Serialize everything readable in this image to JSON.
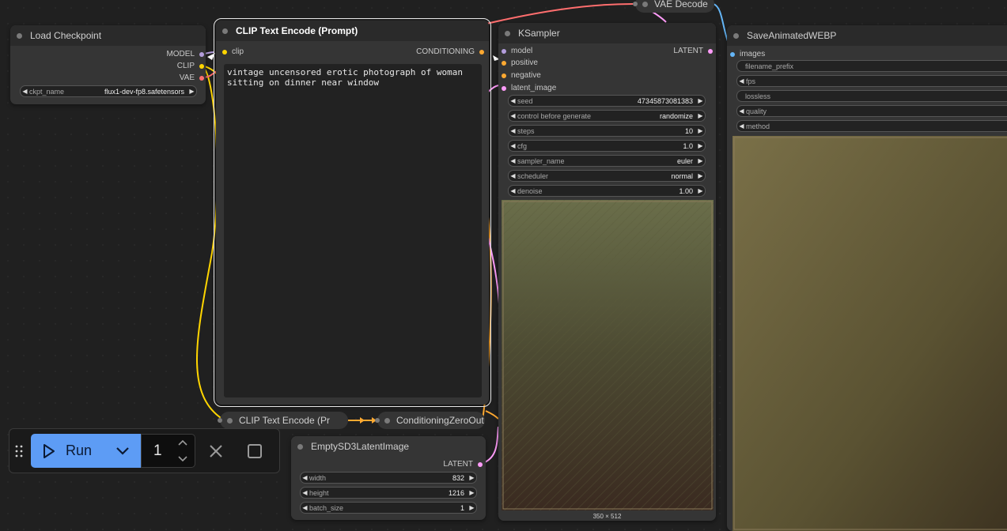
{
  "nodes": {
    "load_checkpoint": {
      "title": "Load Checkpoint",
      "outputs": [
        "MODEL",
        "CLIP",
        "VAE"
      ],
      "widget": {
        "label": "ckpt_name",
        "value": "flux1-dev-fp8.safetensors"
      }
    },
    "clip_text_encode": {
      "title": "CLIP Text Encode (Prompt)",
      "input": "clip",
      "output": "CONDITIONING",
      "prompt": "vintage uncensored erotic photograph of woman\nsitting on dinner near window"
    },
    "ksampler": {
      "title": "KSampler",
      "inputs": [
        "model",
        "positive",
        "negative",
        "latent_image"
      ],
      "output": "LATENT",
      "widgets": [
        {
          "label": "seed",
          "value": "47345873081383"
        },
        {
          "label": "control before generate",
          "value": "randomize"
        },
        {
          "label": "steps",
          "value": "10"
        },
        {
          "label": "cfg",
          "value": "1.0"
        },
        {
          "label": "sampler_name",
          "value": "euler"
        },
        {
          "label": "scheduler",
          "value": "normal"
        },
        {
          "label": "denoise",
          "value": "1.00"
        }
      ],
      "preview_size": "350 × 512"
    },
    "vae_decode": {
      "title": "VAE Decode"
    },
    "save_webp": {
      "title": "SaveAnimatedWEBP",
      "input": "images",
      "widgets": [
        "filename_prefix",
        "fps",
        "lossless",
        "quality",
        "method"
      ]
    },
    "clip_text_encode_2": {
      "title": "CLIP Text Encode (Pr"
    },
    "cond_zero_out": {
      "title": "ConditioningZeroOut"
    },
    "empty_latent": {
      "title": "EmptySD3LatentImage",
      "output": "LATENT",
      "widgets": [
        {
          "label": "width",
          "value": "832"
        },
        {
          "label": "height",
          "value": "1216"
        },
        {
          "label": "batch_size",
          "value": "1"
        }
      ]
    }
  },
  "toolbar": {
    "run_label": "Run",
    "batch_count": "1"
  },
  "colors": {
    "clip": "#ffd500",
    "conditioning": "#ffa931",
    "model": "#b39ddb",
    "vae": "#ff6e6e",
    "latent": "#ff9cf9",
    "image": "#64b5f6",
    "run_button": "#5d9cf5"
  },
  "icons": [
    "drag-handle-icon",
    "play-icon",
    "chevron-down-icon",
    "chevron-up-icon",
    "close-icon",
    "stop-icon"
  ]
}
